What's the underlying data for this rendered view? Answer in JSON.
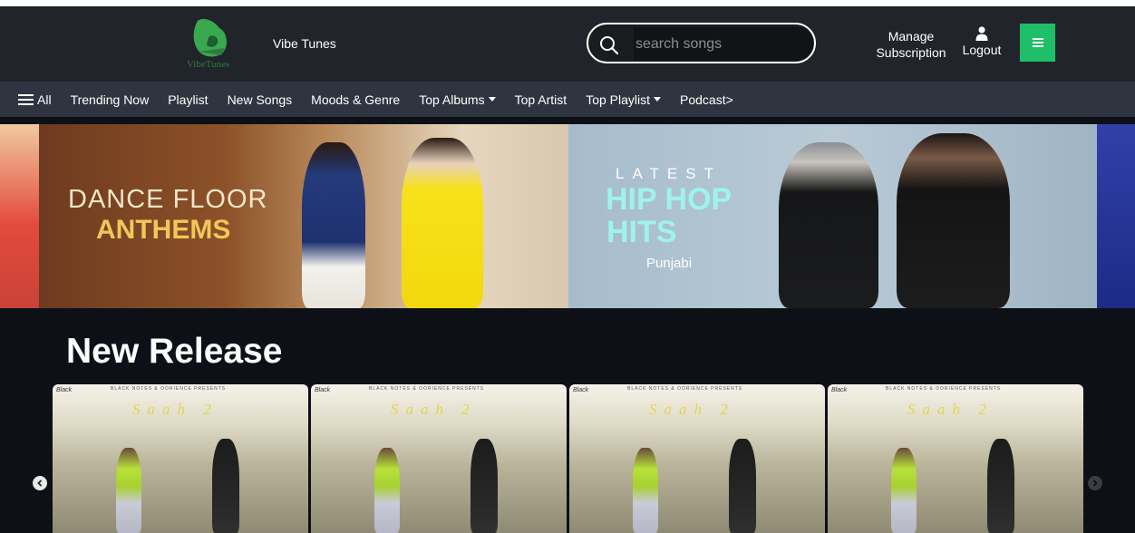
{
  "header": {
    "logo_text": "VibeTunes",
    "brand_name": "Vibe Tunes",
    "search_placeholder": "search songs",
    "manage_line1": "Manage",
    "manage_line2": "Subscription",
    "logout_label": "Logout",
    "accent_color": "#1fbf6a"
  },
  "nav": {
    "all_label": "All",
    "items": [
      {
        "label": "Trending Now"
      },
      {
        "label": "Playlist"
      },
      {
        "label": "New Songs"
      },
      {
        "label": "Moods & Genre"
      },
      {
        "label": "Top Albums",
        "dropdown": true
      },
      {
        "label": "Top Artist"
      },
      {
        "label": "Top Playlist",
        "dropdown": true
      },
      {
        "label": "Podcast>"
      }
    ]
  },
  "banners": [
    {
      "line1": "DANCE FLOOR",
      "line2": "ANTHEMS"
    },
    {
      "line1": "LATEST",
      "line2": "HIP HOP",
      "line3": "HITS",
      "line4": "Punjabi"
    }
  ],
  "new_release": {
    "title": "New Release",
    "cards": [
      {
        "cover_title": "Saah 2",
        "cover_top": "BLACK NOTES & OORIENCE PRESENTS",
        "cover_logo": "Black"
      },
      {
        "cover_title": "Saah 2",
        "cover_top": "BLACK NOTES & OORIENCE PRESENTS",
        "cover_logo": "Black"
      },
      {
        "cover_title": "Saah 2",
        "cover_top": "BLACK NOTES & OORIENCE PRESENTS",
        "cover_logo": "Black"
      },
      {
        "cover_title": "Saah 2",
        "cover_top": "BLACK NOTES & OORIENCE PRESENTS",
        "cover_logo": "Black"
      }
    ]
  }
}
